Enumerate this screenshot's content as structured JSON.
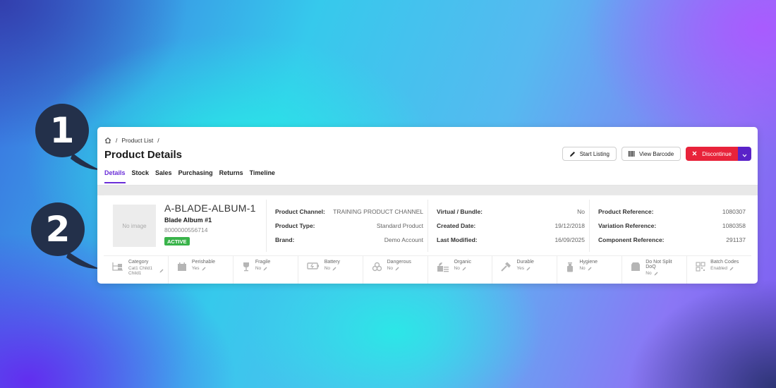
{
  "markers": [
    {
      "number": "1"
    },
    {
      "number": "2"
    }
  ],
  "breadcrumb": {
    "sep": "/",
    "item": "Product List"
  },
  "page_title": "Product Details",
  "tabs": [
    {
      "label": "Details"
    },
    {
      "label": "Stock"
    },
    {
      "label": "Sales"
    },
    {
      "label": "Purchasing"
    },
    {
      "label": "Returns"
    },
    {
      "label": "Timeline"
    }
  ],
  "actions": {
    "start_listing": "Start Listing",
    "view_barcode": "View Barcode",
    "discontinue": "Discontinue"
  },
  "product": {
    "thumb_text": "No image",
    "sku": "A-BLADE-ALBUM-1",
    "name": "Blade Album #1",
    "barcode": "8000000556714",
    "status": "ACTIVE"
  },
  "details": {
    "col1": [
      {
        "key": "Product Channel:",
        "value": "TRAINING PRODUCT CHANNEL"
      },
      {
        "key": "Product Type:",
        "value": "Standard Product"
      },
      {
        "key": "Brand:",
        "value": "Demo Account"
      }
    ],
    "col2": [
      {
        "key": "Virtual / Bundle:",
        "value": "No"
      },
      {
        "key": "Created Date:",
        "value": "19/12/2018"
      },
      {
        "key": "Last Modified:",
        "value": "16/09/2025"
      }
    ],
    "col3": [
      {
        "key": "Product Reference:",
        "value": "1080307"
      },
      {
        "key": "Variation Reference:",
        "value": "1080358"
      },
      {
        "key": "Component Reference:",
        "value": "291137"
      }
    ]
  },
  "attributes": [
    {
      "label": "Category",
      "value": "Cat1 Child1 Child1",
      "icon": "category-icon"
    },
    {
      "label": "Perishable",
      "value": "Yes",
      "icon": "calendar-icon"
    },
    {
      "label": "Fragile",
      "value": "No",
      "icon": "glass-icon"
    },
    {
      "label": "Battery",
      "value": "No",
      "icon": "battery-icon"
    },
    {
      "label": "Dangerous",
      "value": "No",
      "icon": "biohazard-icon"
    },
    {
      "label": "Organic",
      "value": "No",
      "icon": "organic-icon"
    },
    {
      "label": "Durable",
      "value": "Yes",
      "icon": "hammer-icon"
    },
    {
      "label": "Hygiene",
      "value": "No",
      "icon": "spray-icon"
    },
    {
      "label": "Do Not Split DoQ",
      "value": "No",
      "icon": "box-icon"
    },
    {
      "label": "Batch Codes",
      "value": "Enabled",
      "icon": "batch-icon"
    }
  ],
  "colors": {
    "accent": "#6a2ed8",
    "danger": "#e8233a",
    "caret": "#5a22c8",
    "active": "#39b34a",
    "marker": "#23304a"
  }
}
